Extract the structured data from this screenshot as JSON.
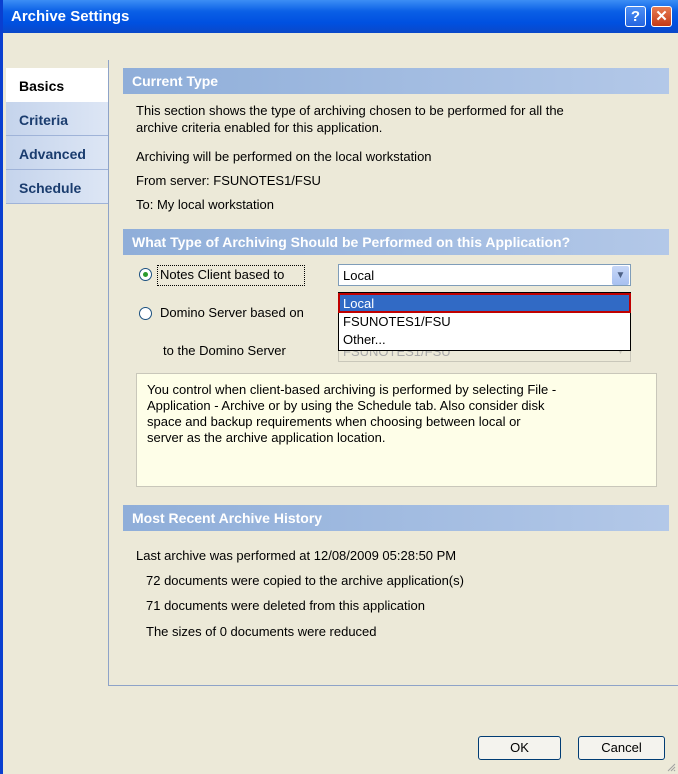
{
  "window": {
    "title": "Archive Settings",
    "help_glyph": "?",
    "close_glyph": "✕"
  },
  "tabs": [
    {
      "label": "Basics",
      "active": true
    },
    {
      "label": "Criteria",
      "active": false
    },
    {
      "label": "Advanced",
      "active": false
    },
    {
      "label": "Schedule",
      "active": false
    }
  ],
  "current_type": {
    "header": "Current Type",
    "description_line1": "This section shows the type of archiving chosen to be performed for all the",
    "description_line2": "archive criteria enabled for this application.",
    "line1": "Archiving will be performed on the local workstation",
    "line2": "From server: FSUNOTES1/FSU",
    "line3": "To: My local workstation"
  },
  "archiving_type": {
    "header": "What Type of Archiving Should be Performed on this Application?",
    "option_client_label": "Notes Client based to",
    "option_client_selected": true,
    "client_select_value": "Local",
    "option_server_label": "Domino Server based on",
    "option_server_selected": false,
    "server_select_value": "",
    "to_server_label": "to the Domino Server",
    "to_server_select_value": "FSUNOTES1/FSU",
    "dropdown_options": [
      "Local",
      "FSUNOTES1/FSU",
      "Other..."
    ],
    "dropdown_highlighted": "Local",
    "info_text": "You control when client-based archiving is performed by selecting File -\nApplication - Archive or by using the Schedule tab.  Also consider disk\nspace and backup requirements when choosing between local or\nserver as the archive application location."
  },
  "history": {
    "header": "Most Recent Archive History",
    "line1": "Last archive was performed at 12/08/2009 05:28:50 PM",
    "line2": "72 documents were copied to the archive application(s)",
    "line3": "71 documents were deleted from this application",
    "line4": "The sizes of 0 documents were reduced"
  },
  "buttons": {
    "ok": "OK",
    "cancel": "Cancel"
  },
  "colors": {
    "title_bar": "#0054e3",
    "section_header": "#9db8e0",
    "selection": "#316ac5",
    "highlight_outline": "#c00000"
  }
}
